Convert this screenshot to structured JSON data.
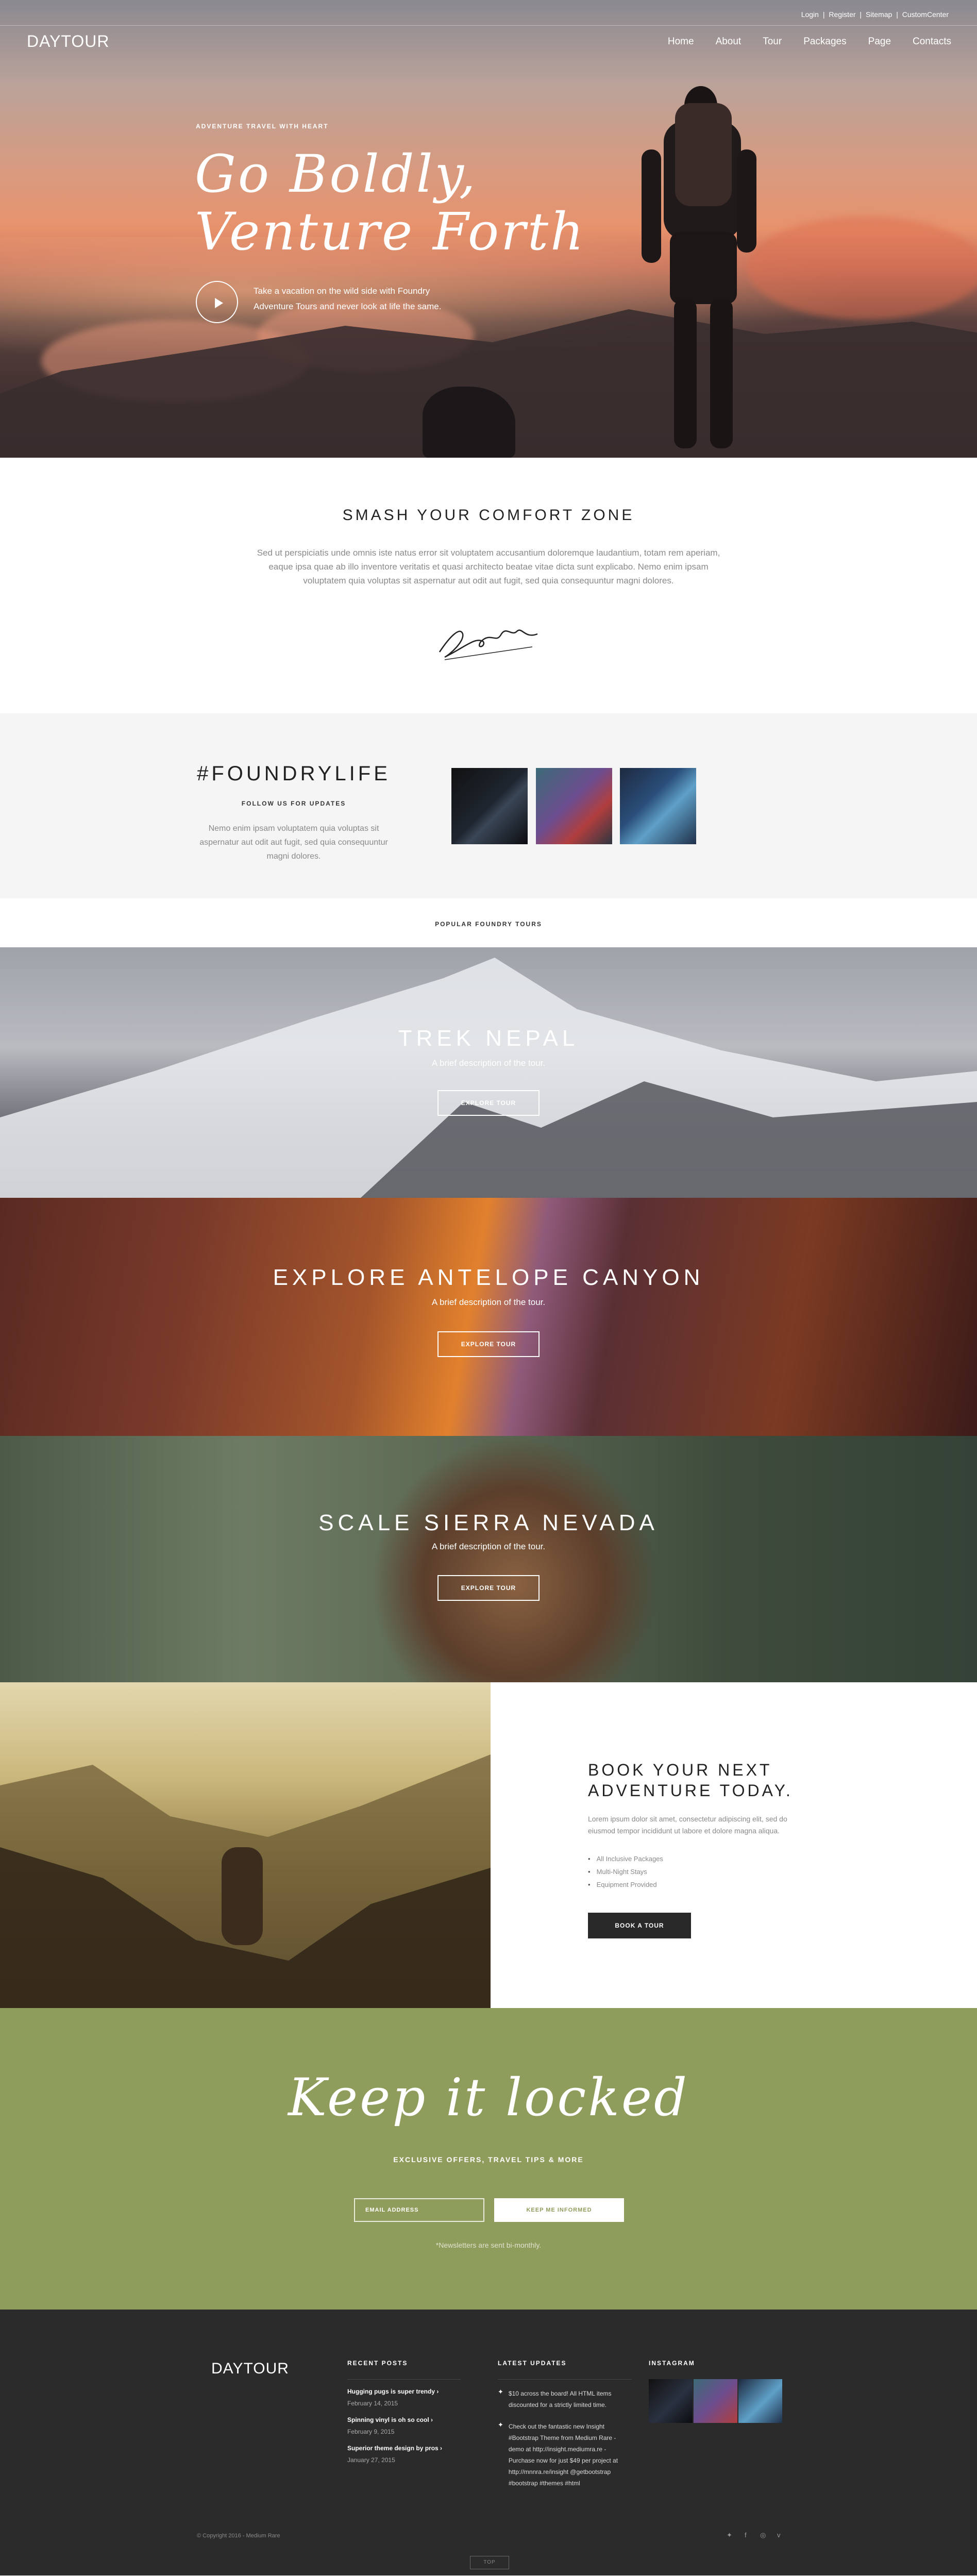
{
  "topbar": {
    "links": [
      "Login",
      "|",
      "Register",
      "|",
      "Sitemap",
      "|",
      "CustomCenter"
    ]
  },
  "header": {
    "logo": "DAYTOUR",
    "nav": [
      "Home",
      "About",
      "Tour",
      "Packages",
      "Page",
      "Contacts"
    ]
  },
  "hero": {
    "eyebrow": "ADVENTURE TRAVEL WITH HEART",
    "title_line1": "Go Boldly,",
    "title_line2": "Venture Forth",
    "description": "Take a vacation on the wild side with Foundry Adventure Tours and never look at life the same."
  },
  "comfort": {
    "title": "SMASH YOUR COMFORT ZONE",
    "text": "Sed ut perspiciatis unde omnis iste natus error sit voluptatem accusantium doloremque laudantium, totam rem aperiam, eaque ipsa quae ab illo inventore veritatis et quasi architecto beatae vitae dicta sunt explicabo. Nemo enim ipsam voluptatem quia voluptas sit aspernatur aut odit aut fugit, sed quia consequuntur magni dolores.",
    "signature": "LaraCroft"
  },
  "foundry": {
    "title": "#FOUNDRYLIFE",
    "follow": "FOLLOW US FOR UPDATES",
    "text": "Nemo enim ipsam voluptatem quia voluptas sit aspernatur aut odit aut fugit, sed quia consequuntur magni dolores."
  },
  "popular": {
    "label": "POPULAR FOUNDRY TOURS"
  },
  "tours": [
    {
      "title": "TREK NEPAL",
      "desc": "A brief description of the tour.",
      "button": "EXPLORE TOUR"
    },
    {
      "title": "EXPLORE ANTELOPE CANYON",
      "desc": "A brief description of the tour.",
      "button": "EXPLORE TOUR"
    },
    {
      "title": "SCALE SIERRA NEVADA",
      "desc": "A brief description of the tour.",
      "button": "EXPLORE TOUR"
    }
  ],
  "book": {
    "title_line1": "BOOK YOUR NEXT",
    "title_line2": "ADVENTURE TODAY.",
    "text": "Lorem ipsum dolor sit amet, consectetur adipiscing elit, sed do eiusmod tempor incididunt ut labore et dolore magna aliqua.",
    "items": [
      "All Inclusive Packages",
      "Multi-Night Stays",
      "Equipment Provided"
    ],
    "button": "BOOK A TOUR"
  },
  "locked": {
    "title": "Keep it locked",
    "subtitle": "EXCLUSIVE OFFERS, TRAVEL TIPS & MORE",
    "email_placeholder": "EMAIL ADDRESS",
    "button": "KEEP ME INFORMED",
    "note": "*Newsletters are sent bi-monthly."
  },
  "footer": {
    "logo": "DAYTOUR",
    "recent_heading": "RECENT POSTS",
    "posts": [
      {
        "title": "Hugging pugs is super trendy",
        "date": "February 14, 2015"
      },
      {
        "title": "Spinning vinyl is oh so cool",
        "date": "February 9, 2015"
      },
      {
        "title": "Superior theme design by pros",
        "date": "January 27, 2015"
      }
    ],
    "updates_heading": "LATEST UPDATES",
    "tweets": [
      "$10 across the board! All HTML items discounted for a strictly limited time.",
      "Check out the fantastic new Insight #Bootstrap Theme from Medium Rare - demo at http://insight.mediumra.re - Purchase now for just $49 per project at http://mnnra.re/insight @getbootstrap #bootstrap #themes #html"
    ],
    "instagram_heading": "INSTAGRAM",
    "copyright": "© Copyright 2016 - Medium Rare",
    "social": [
      "twitter-icon",
      "facebook-icon",
      "instagram-icon",
      "vimeo-icon"
    ],
    "totop": "TOP"
  },
  "colors": {
    "olive": "#8f9d5c",
    "footer_bg": "#2b2b2b",
    "dark_button": "#292929"
  }
}
